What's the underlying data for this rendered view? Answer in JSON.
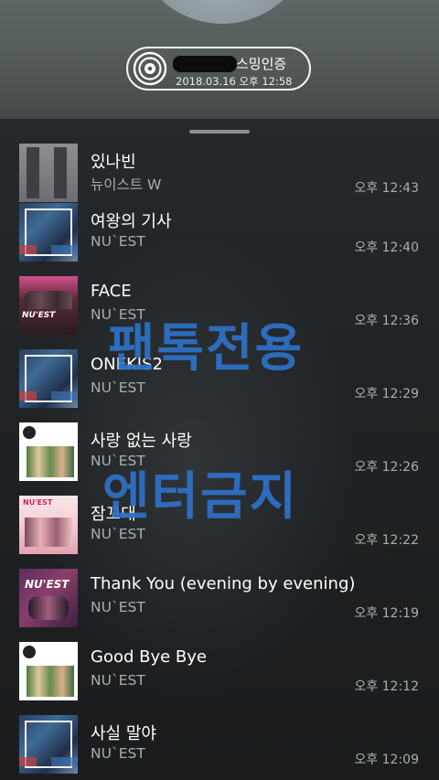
{
  "header": {
    "cover_text": "",
    "certificate": {
      "title": "스밍인증",
      "date": "2018.03.16 오후 12:58"
    }
  },
  "history": [
    {
      "title": "있나빈",
      "artist": "뉴이스트 W",
      "time": "오후 12:43",
      "art": "art-b"
    },
    {
      "title": "여왕의 기사",
      "artist": "NU`EST",
      "time": "오후 12:40",
      "art": "art-a"
    },
    {
      "title": "FACE",
      "artist": "NU`EST",
      "time": "오후 12:36",
      "art": "art-face"
    },
    {
      "title": "ONEKIS2",
      "artist": "NU`EST",
      "time": "오후 12:29",
      "art": "art-a"
    },
    {
      "title": "사랑 없는 사랑",
      "artist": "NU`EST",
      "time": "오후 12:26",
      "art": "art-love"
    },
    {
      "title": "잠꼬대",
      "artist": "NU`EST",
      "time": "오후 12:22",
      "art": "art-sleep"
    },
    {
      "title": "Thank You (evening by evening)",
      "artist": "NU`EST",
      "time": "오후 12:19",
      "art": "art-ty"
    },
    {
      "title": "Good Bye Bye",
      "artist": "NU`EST",
      "time": "오후 12:12",
      "art": "art-love"
    },
    {
      "title": "사실 말야",
      "artist": "NU`EST",
      "time": "오후 12:09",
      "art": "art-a"
    }
  ],
  "watermark": {
    "line1": "팬톡전용",
    "line2": "엔터금지",
    "color": "#2e72c9"
  }
}
